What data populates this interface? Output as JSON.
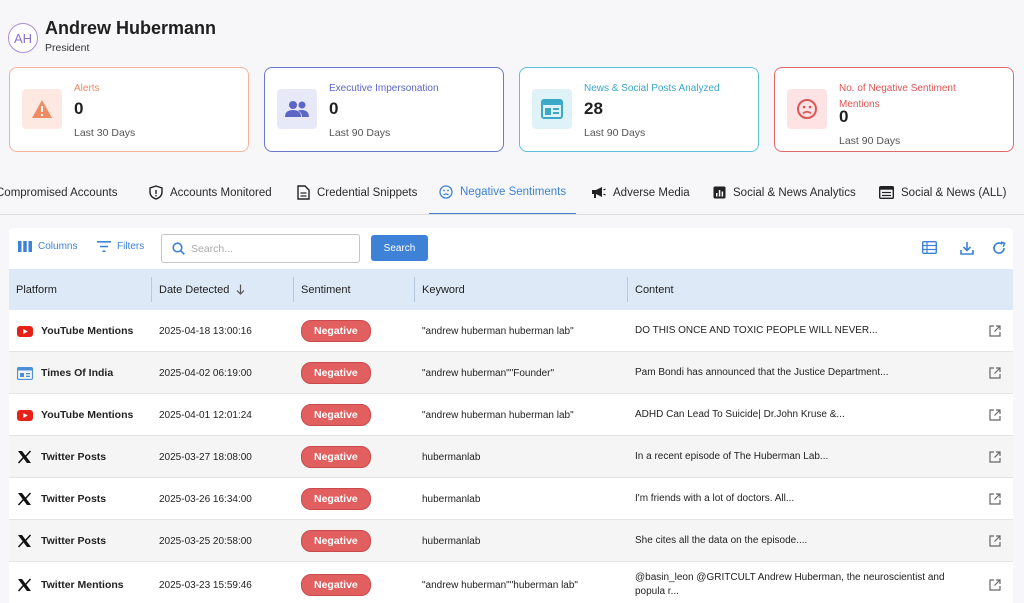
{
  "profile": {
    "initials": "AH",
    "name": "Andrew Hubermann",
    "role": "President"
  },
  "cards": [
    {
      "label": "Alerts",
      "value": "0",
      "sub": "Last 30 Days",
      "icon": "warning-icon",
      "color": "#ef8b63"
    },
    {
      "label": "Executive Impersonation",
      "value": "0",
      "sub": "Last 90 Days",
      "icon": "users-icon",
      "color": "#5c66c6"
    },
    {
      "label": "News & Social Posts Analyzed",
      "value": "28",
      "sub": "Last 90 Days",
      "icon": "news-icon",
      "color": "#3aa9c8"
    },
    {
      "label": "No. of Negative Sentiment Mentions",
      "value": "0",
      "sub": "Last 90 Days",
      "icon": "sad-face-icon",
      "color": "#e05555"
    }
  ],
  "tabs": [
    {
      "label": "Compromised Accounts",
      "icon": ""
    },
    {
      "label": "Accounts Monitored",
      "icon": "shield-icon"
    },
    {
      "label": "Credential Snippets",
      "icon": "document-icon"
    },
    {
      "label": "Negative Sentiments",
      "icon": "sad-face-icon",
      "active": true
    },
    {
      "label": "Adverse Media",
      "icon": "megaphone-icon"
    },
    {
      "label": "Social & News Analytics",
      "icon": "analytics-icon"
    },
    {
      "label": "Social & News (ALL)",
      "icon": "list-icon"
    }
  ],
  "toolbar": {
    "columns_label": "Columns",
    "filters_label": "Filters",
    "search_placeholder": "Search...",
    "search_button": "Search"
  },
  "table": {
    "columns": [
      "Platform",
      "Date Detected",
      "Sentiment",
      "Keyword",
      "Content"
    ],
    "rows": [
      {
        "platform": "YouTube Mentions",
        "icon": "youtube-icon",
        "date": "2025-04-18 13:00:16",
        "sentiment": "Negative",
        "keyword": "\"andrew huberman huberman lab\"",
        "content": "DO THIS ONCE AND TOXIC PEOPLE WILL NEVER..."
      },
      {
        "platform": "Times Of India",
        "icon": "news-site-icon",
        "date": "2025-04-02 06:19:00",
        "sentiment": "Negative",
        "keyword": "\"andrew huberman\"\"Founder\"",
        "content": "Pam Bondi has announced that the Justice Department..."
      },
      {
        "platform": "YouTube Mentions",
        "icon": "youtube-icon",
        "date": "2025-04-01 12:01:24",
        "sentiment": "Negative",
        "keyword": "\"andrew huberman huberman lab\"",
        "content": "ADHD Can Lead To Suicide| Dr.John Kruse &..."
      },
      {
        "platform": "Twitter Posts",
        "icon": "x-icon",
        "date": "2025-03-27 18:08:00",
        "sentiment": "Negative",
        "keyword": "hubermanlab",
        "content": "In a recent episode of The Huberman Lab..."
      },
      {
        "platform": "Twitter Posts",
        "icon": "x-icon",
        "date": "2025-03-26 16:34:00",
        "sentiment": "Negative",
        "keyword": "hubermanlab",
        "content": "I'm friends with a lot of doctors. All..."
      },
      {
        "platform": "Twitter Posts",
        "icon": "x-icon",
        "date": "2025-03-25 20:58:00",
        "sentiment": "Negative",
        "keyword": "hubermanlab",
        "content": "She cites all the data on the episode...."
      },
      {
        "platform": "Twitter Mentions",
        "icon": "x-icon",
        "date": "2025-03-23 15:59:46",
        "sentiment": "Negative",
        "keyword": "\"andrew huberman\"\"huberman lab\"",
        "content": "@basin_leon @GRITCULT Andrew Huberman, the neuroscientist and popula r..."
      }
    ]
  }
}
